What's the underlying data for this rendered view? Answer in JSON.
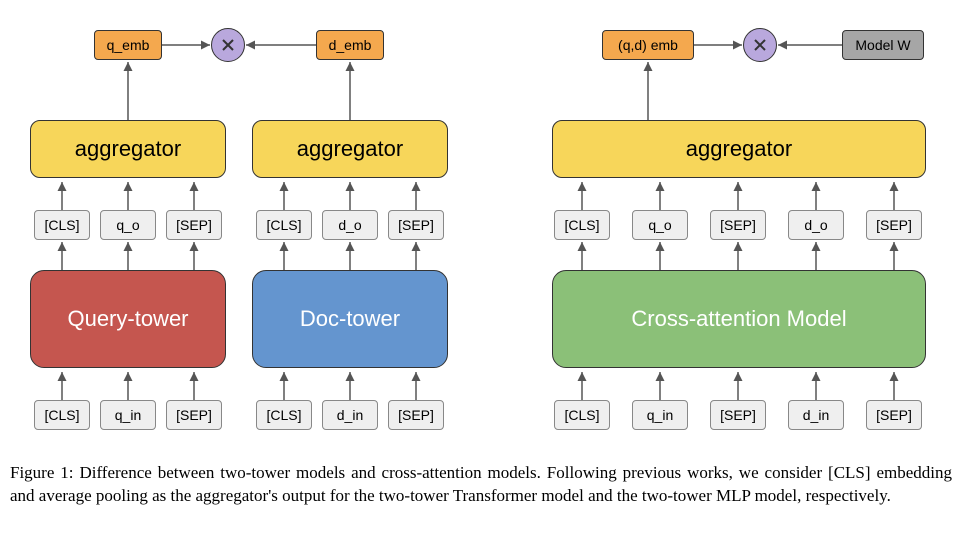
{
  "tokens": {
    "cls": "[CLS]",
    "sep": "[SEP]",
    "q_in": "q_in",
    "q_o": "q_o",
    "d_in": "d_in",
    "d_o": "d_o"
  },
  "outputs": {
    "q_emb": "q_emb",
    "d_emb": "d_emb",
    "qd_emb": "(q,d) emb",
    "model_w": "Model W"
  },
  "blocks": {
    "aggregator": "aggregator",
    "query_tower": "Query-tower",
    "doc_tower": "Doc-tower",
    "cross_attention": "Cross-attention Model"
  },
  "multiply_symbol": "×",
  "caption": "Figure 1: Difference between two-tower models and cross-attention models. Following previous works, we consider [CLS] embedding and average pooling as the aggregator's output for the two-tower Transformer model and the two-tower MLP model, respectively."
}
